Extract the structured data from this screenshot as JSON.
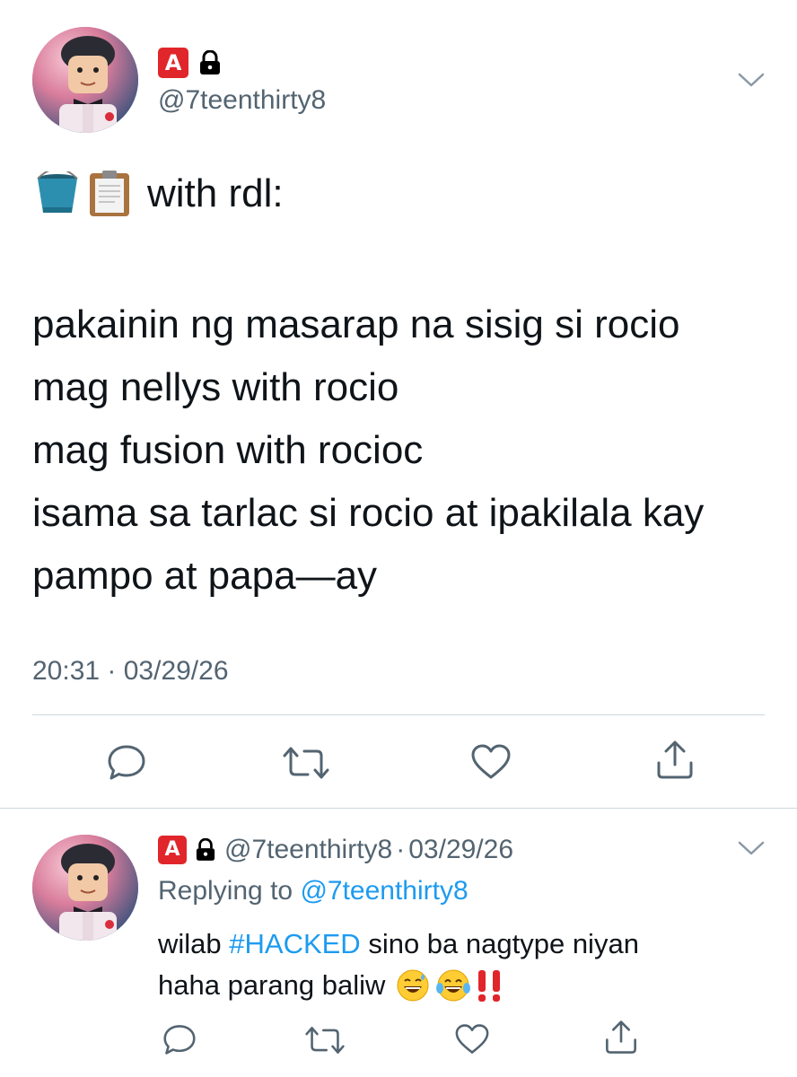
{
  "main_tweet": {
    "badge": "A",
    "handle": "@7teenthirty8",
    "body_intro": "with rdl:",
    "body_lines": [
      "pakainin ng masarap na sisig si rocio",
      "mag nellys with rocio",
      "mag fusion with rocioc",
      "isama sa tarlac si rocio at ipakilala kay",
      "pampo at papa—ay"
    ],
    "timestamp": "20:31 · 03/29/26"
  },
  "reply_tweet": {
    "badge": "A",
    "handle": "@7teenthirty8",
    "separator": "·",
    "date": "03/29/26",
    "replying_prefix": "Replying to ",
    "replying_handle": "@7teenthirty8",
    "text_before_tag": "wilab ",
    "hashtag": "#HACKED",
    "text_after_tag": " sino ba nagtype niyan",
    "line2_text": "haha parang baliw"
  },
  "icons": {
    "lock": "lock-icon",
    "chevron": "chevron-down-icon",
    "reply": "reply-icon",
    "retweet": "retweet-icon",
    "like": "like-icon",
    "share": "share-icon",
    "bucket": "bucket-emoji",
    "clipboard": "clipboard-emoji",
    "sweat_smile": "sweat-smile-emoji",
    "joy": "joy-emoji",
    "double_exclaim": "double-exclamation-emoji"
  },
  "colors": {
    "text": "#0f1419",
    "muted": "#536471",
    "link": "#1d9bf0",
    "badge": "#e0262b",
    "divider": "#cfd9de"
  }
}
